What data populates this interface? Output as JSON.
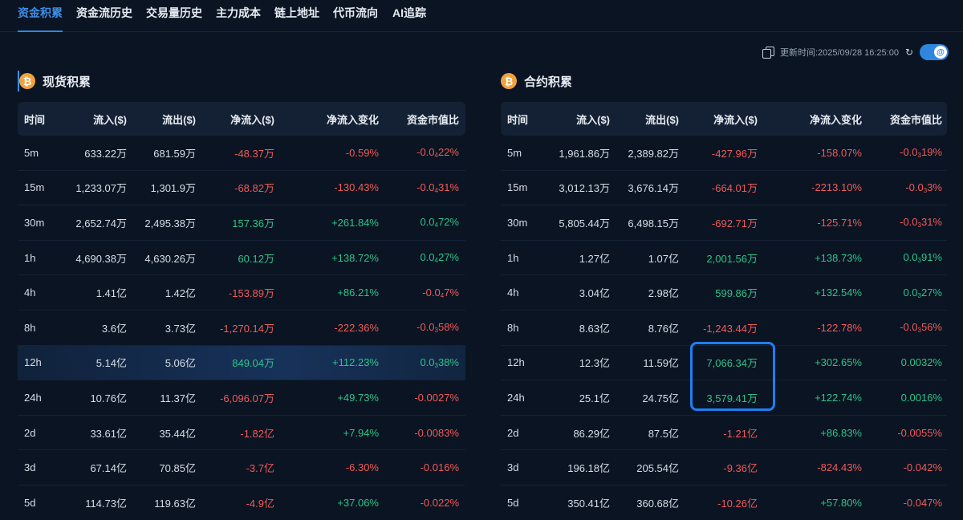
{
  "tabs": [
    {
      "label": "资金积累",
      "active": true
    },
    {
      "label": "资金流历史",
      "active": false
    },
    {
      "label": "交易量历史",
      "active": false
    },
    {
      "label": "主力成本",
      "active": false
    },
    {
      "label": "链上地址",
      "active": false
    },
    {
      "label": "代币流向",
      "active": false
    },
    {
      "label": "AI追踪",
      "active": false
    }
  ],
  "update": {
    "text": "更新时间:2025/09/28 16:25:00"
  },
  "colors": {
    "positive": "#2ec38a",
    "negative": "#f05a5a",
    "accent": "#2f86e0",
    "coin": "#f2a23a"
  },
  "columns": [
    "时间",
    "流入($)",
    "流出($)",
    "净流入($)",
    "净流入变化",
    "资金市值比"
  ],
  "spot": {
    "title": "现货积累",
    "coin_symbol": "₿",
    "rows": [
      [
        "5m",
        "633.22万",
        "681.59万",
        "-48.37万",
        "-0.59%",
        [
          "-0.0",
          "4",
          "22%"
        ]
      ],
      [
        "15m",
        "1,233.07万",
        "1,301.9万",
        "-68.82万",
        "-130.43%",
        [
          "-0.0",
          "4",
          "31%"
        ]
      ],
      [
        "30m",
        "2,652.74万",
        "2,495.38万",
        "157.36万",
        "+261.84%",
        [
          "0.0",
          "4",
          "72%"
        ]
      ],
      [
        "1h",
        "4,690.38万",
        "4,630.26万",
        "60.12万",
        "+138.72%",
        [
          "0.0",
          "4",
          "27%"
        ]
      ],
      [
        "4h",
        "1.41亿",
        "1.42亿",
        "-153.89万",
        "+86.21%",
        [
          "-0.0",
          "4",
          "7%"
        ]
      ],
      [
        "8h",
        "3.6亿",
        "3.73亿",
        "-1,270.14万",
        "-222.36%",
        [
          "-0.0",
          "3",
          "58%"
        ]
      ],
      [
        "12h",
        "5.14亿",
        "5.06亿",
        "849.04万",
        "+112.23%",
        [
          "0.0",
          "3",
          "38%"
        ]
      ],
      [
        "24h",
        "10.76亿",
        "11.37亿",
        "-6,096.07万",
        "+49.73%",
        "-0.0027%"
      ],
      [
        "2d",
        "33.61亿",
        "35.44亿",
        "-1.82亿",
        "+7.94%",
        "-0.0083%"
      ],
      [
        "3d",
        "67.14亿",
        "70.85亿",
        "-3.7亿",
        "-6.30%",
        "-0.016%"
      ],
      [
        "5d",
        "114.73亿",
        "119.63亿",
        "-4.9亿",
        "+37.06%",
        "-0.022%"
      ]
    ]
  },
  "futures": {
    "title": "合约积累",
    "coin_symbol": "₿",
    "rows": [
      [
        "5m",
        "1,961.86万",
        "2,389.82万",
        "-427.96万",
        "-158.07%",
        [
          "-0.0",
          "3",
          "19%"
        ]
      ],
      [
        "15m",
        "3,012.13万",
        "3,676.14万",
        "-664.01万",
        "-2213.10%",
        [
          "-0.0",
          "3",
          "3%"
        ]
      ],
      [
        "30m",
        "5,805.44万",
        "6,498.15万",
        "-692.71万",
        "-125.71%",
        [
          "-0.0",
          "3",
          "31%"
        ]
      ],
      [
        "1h",
        "1.27亿",
        "1.07亿",
        "2,001.56万",
        "+138.73%",
        [
          "0.0",
          "3",
          "91%"
        ]
      ],
      [
        "4h",
        "3.04亿",
        "2.98亿",
        "599.86万",
        "+132.54%",
        [
          "0.0",
          "3",
          "27%"
        ]
      ],
      [
        "8h",
        "8.63亿",
        "8.76亿",
        "-1,243.44万",
        "-122.78%",
        [
          "-0.0",
          "3",
          "56%"
        ]
      ],
      [
        "12h",
        "12.3亿",
        "11.59亿",
        "7,066.34万",
        "+302.65%",
        "0.0032%"
      ],
      [
        "24h",
        "25.1亿",
        "24.75亿",
        "3,579.41万",
        "+122.74%",
        "0.0016%"
      ],
      [
        "2d",
        "86.29亿",
        "87.5亿",
        "-1.21亿",
        "+86.83%",
        "-0.0055%"
      ],
      [
        "3d",
        "196.18亿",
        "205.54亿",
        "-9.36亿",
        "-824.43%",
        "-0.042%"
      ],
      [
        "5d",
        "350.41亿",
        "360.68亿",
        "-10.26亿",
        "+57.80%",
        "-0.047%"
      ]
    ]
  }
}
